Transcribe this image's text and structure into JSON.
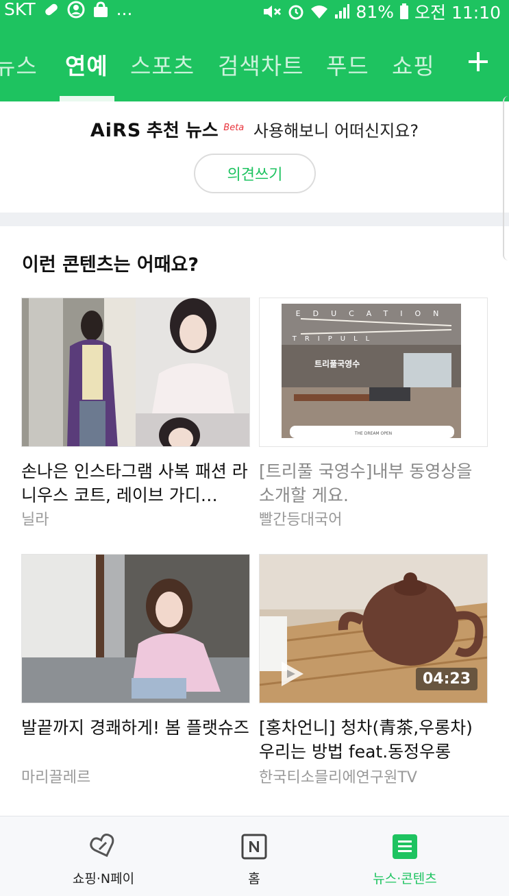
{
  "status_bar": {
    "carrier": "SKT",
    "more": "...",
    "battery": "81%",
    "time": "오전 11:10"
  },
  "nav_tabs": [
    {
      "label": "뉴스"
    },
    {
      "label": "연예"
    },
    {
      "label": "스포츠"
    },
    {
      "label": "검색차트"
    },
    {
      "label": "푸드"
    },
    {
      "label": "쇼핑"
    }
  ],
  "nav_active": "연예",
  "airs": {
    "logo": "AiRS",
    "title": "추천 뉴스",
    "beta": "Beta",
    "question": "사용해보니 어떠신지요?",
    "button": "의견쓰기"
  },
  "contents": {
    "title": "이런 콘텐츠는 어때요?",
    "cards": [
      {
        "title": "손나은 인스타그램 사복 패션 라니우스 코트, 레이브 가디…",
        "source": "닐라"
      },
      {
        "title": "[트리풀 국영수]내부 동영상을 소개할 게요.",
        "source": "빨간등대국어",
        "thumb_sign": "EDUCATION",
        "thumb_sign2": "TRIPULL",
        "thumb_name": "트리풀국영수",
        "thumb_footer": "THE DREAM OPEN"
      },
      {
        "title": "발끝까지 경쾌하게! 봄 플랫슈즈",
        "source": "마리끌레르"
      },
      {
        "title": "[홍차언니] 청차(青茶,우롱차) 우리는 방법 feat.동정우롱",
        "source": "한국티소믈리에연구원TV",
        "duration": "04:23"
      }
    ]
  },
  "bottom_nav": [
    {
      "label": "쇼핑·N페이",
      "icon": "heart-link-icon"
    },
    {
      "label": "홈",
      "icon": "naver-n-icon"
    },
    {
      "label": "뉴스·콘텐츠",
      "icon": "news-icon"
    }
  ],
  "colors": {
    "brand": "#1ec360",
    "read_title": "#888888"
  }
}
